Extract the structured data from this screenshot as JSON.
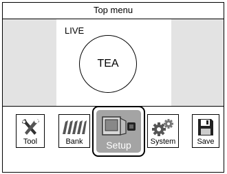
{
  "header": {
    "title": "Top menu"
  },
  "screen": {
    "live_label": "LIVE",
    "circle_text": "TEA"
  },
  "menu": {
    "items": [
      {
        "label": "Tool",
        "icon": "tool-icon"
      },
      {
        "label": "Bank",
        "icon": "bank-icon"
      },
      {
        "label": "Setup",
        "icon": "setup-icon",
        "selected": true
      },
      {
        "label": "System",
        "icon": "system-icon"
      },
      {
        "label": "Save",
        "icon": "save-icon"
      }
    ]
  },
  "colors": {
    "side_panel": "#e3e3e3",
    "selected_bg": "#a4a4a4",
    "border": "#000000"
  }
}
